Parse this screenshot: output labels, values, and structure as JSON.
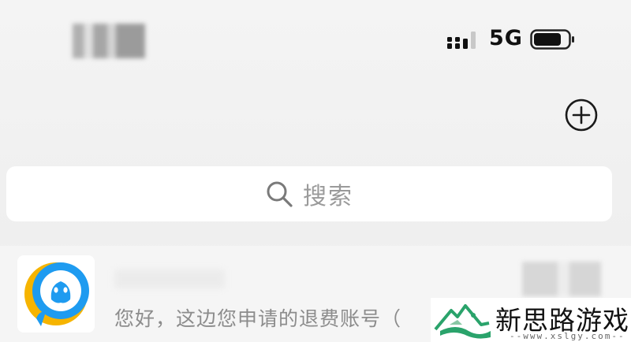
{
  "status_bar": {
    "network": "5G",
    "signal_icon": "signal-bars-icon",
    "battery_icon": "battery-icon"
  },
  "toolbar": {
    "add_icon": "plus-circle-icon"
  },
  "search": {
    "icon": "search-icon",
    "placeholder": "搜索"
  },
  "chats": [
    {
      "avatar_icon": "qq-penguin-icon",
      "preview": "您好，这边您申请的退费账号（"
    }
  ],
  "watermark": {
    "title": "新思路游戏",
    "url": "--www.xslgy.com--",
    "logo_icon": "mountain-logo-icon"
  },
  "colors": {
    "background": "#f2f2f2",
    "search_bg": "#ffffff",
    "placeholder": "#9a9a9a",
    "preview_text": "#8c8c8c",
    "qq_blue": "#1e9bf0",
    "qq_yellow": "#f6b400",
    "logo_green": "#2aa36b"
  }
}
